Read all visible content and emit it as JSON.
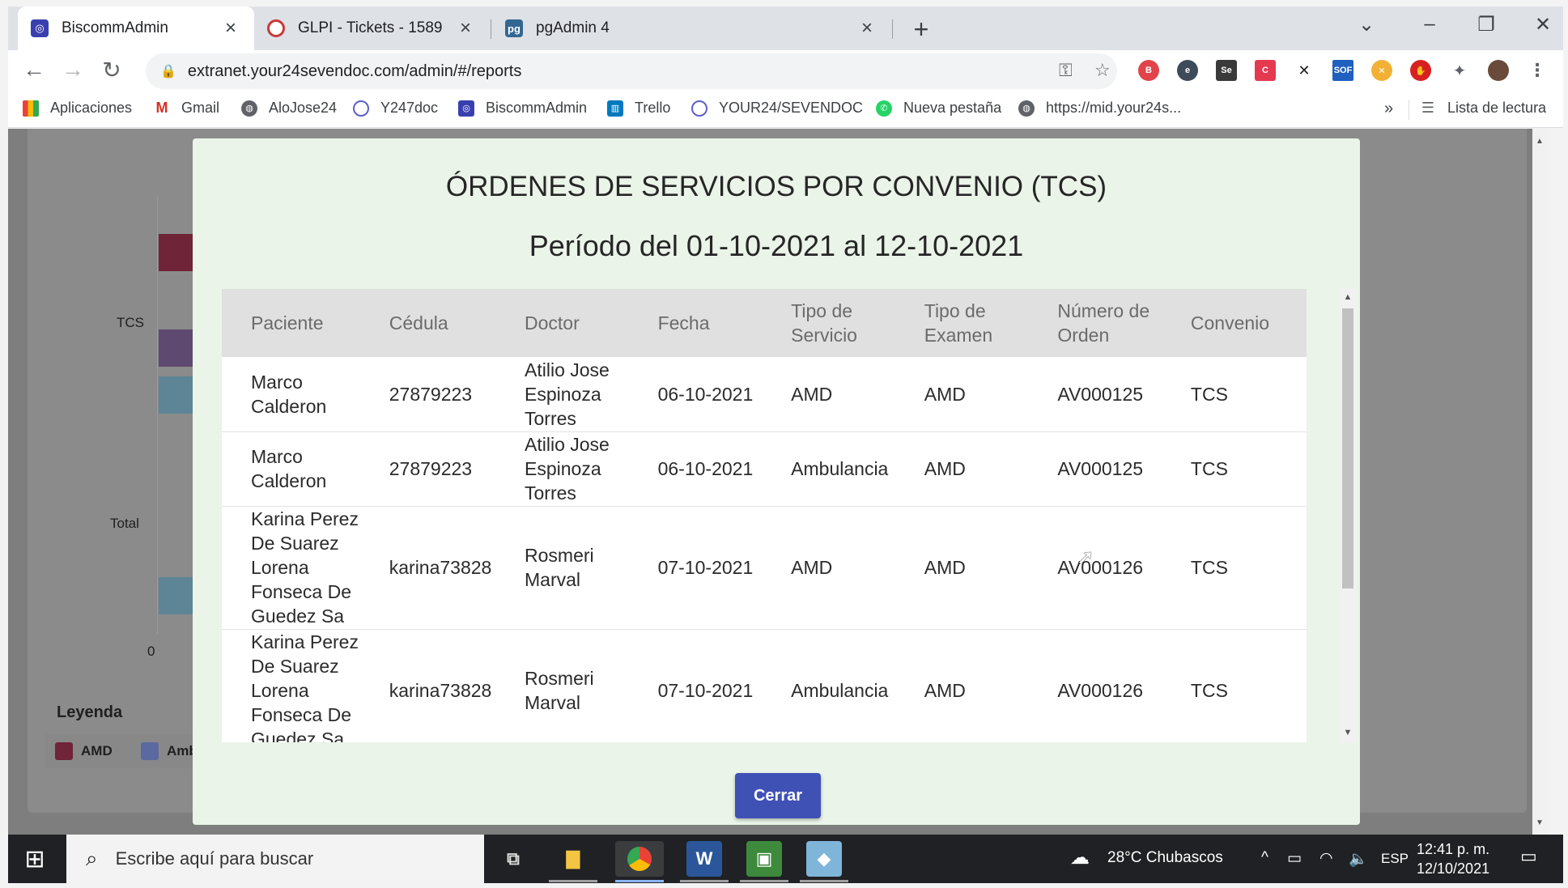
{
  "browser": {
    "tabs": [
      {
        "title": "BiscommAdmin",
        "active": true
      },
      {
        "title": "GLPI - Tickets - 1589",
        "active": false
      },
      {
        "title": "pgAdmin 4",
        "active": false
      }
    ],
    "url": "extranet.your24sevendoc.com/admin/#/reports",
    "bookmarks": [
      "Aplicaciones",
      "Gmail",
      "AloJose24",
      "Y247doc",
      "BiscommAdmin",
      "Trello",
      "YOUR24/SEVENDOC",
      "Nueva pestaña",
      "https://mid.your24s..."
    ],
    "bookmarks_more": "»",
    "reading_list": "Lista de lectura"
  },
  "background_chart": {
    "y_labels": [
      "TCS",
      "Total"
    ],
    "x_tick": "0",
    "legend_title": "Leyenda",
    "legend": [
      "AMD",
      "Ambu"
    ],
    "colors": {
      "amd": "#6f2437",
      "ambulancia": "#5a6aa0"
    }
  },
  "modal": {
    "title": "ÓRDENES DE SERVICIOS POR CONVENIO (TCS)",
    "period": "Período del 01-10-2021 al 12-10-2021",
    "columns": [
      "Paciente",
      "Cédula",
      "Doctor",
      "Fecha",
      "Tipo de Servicio",
      "Tipo de Examen",
      "Número de Orden",
      "Convenio"
    ],
    "rows": [
      [
        "Marco Calderon",
        "27879223",
        "Atilio Jose Espinoza Torres",
        "06-10-2021",
        "AMD",
        "AMD",
        "AV000125",
        "TCS"
      ],
      [
        "Marco Calderon",
        "27879223",
        "Atilio Jose Espinoza Torres",
        "06-10-2021",
        "Ambulancia",
        "AMD",
        "AV000125",
        "TCS"
      ],
      [
        "Karina Perez De Suarez Lorena Fonseca De Guedez Sa",
        "karina73828",
        "Rosmeri Marval",
        "07-10-2021",
        "AMD",
        "AMD",
        "AV000126",
        "TCS"
      ],
      [
        "Karina Perez De Suarez Lorena Fonseca De Guedez Sa",
        "karina73828",
        "Rosmeri Marval",
        "07-10-2021",
        "Ambulancia",
        "AMD",
        "AV000126",
        "TCS"
      ]
    ],
    "close_label": "Cerrar",
    "accent": "#3f51b5"
  },
  "taskbar": {
    "search_placeholder": "Escribe aquí para buscar",
    "weather": "28°C  Chubascos",
    "language": "ESP",
    "time": "12:41 p. m.",
    "date": "12/10/2021"
  }
}
